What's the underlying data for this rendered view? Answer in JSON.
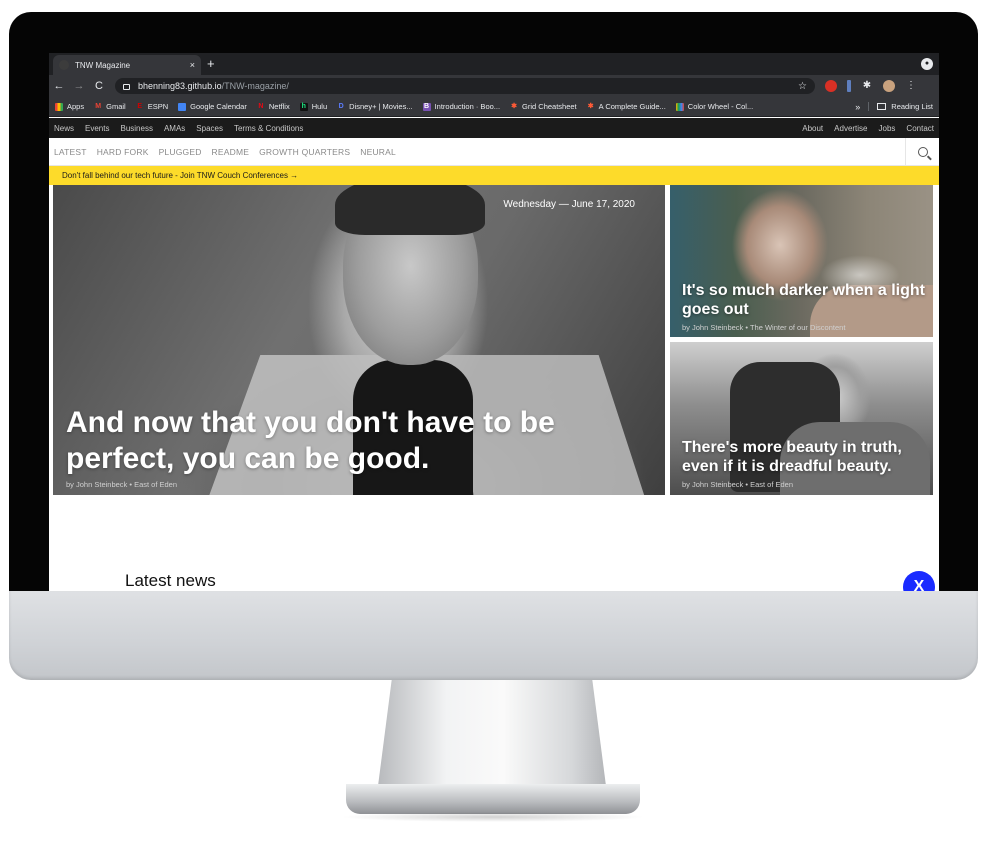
{
  "browser": {
    "tab_title": "TNW Magazine",
    "new_tab": "+",
    "tab_close": "×",
    "profile": "●",
    "url_host": "bhenning83.github.io",
    "url_path": "/TNW-magazine/",
    "back": "←",
    "forward": "→",
    "reload": "C",
    "star": "☆",
    "extensions_glyph": "✱",
    "menu_glyph": "⋮",
    "bookmarks": [
      {
        "label": "Apps",
        "icon": "apps-grid-icon",
        "color": "#ea4335"
      },
      {
        "label": "Gmail",
        "icon": "gmail-icon",
        "color": "#ea4335"
      },
      {
        "label": "ESPN",
        "icon": "espn-icon",
        "color": "#d00000"
      },
      {
        "label": "Google Calendar",
        "icon": "calendar-icon",
        "color": "#4285f4"
      },
      {
        "label": "Netflix",
        "icon": "netflix-icon",
        "color": "#e50914"
      },
      {
        "label": "Hulu",
        "icon": "hulu-icon",
        "color": "#1ce783"
      },
      {
        "label": "Disney+ | Movies...",
        "icon": "disney-icon",
        "color": "#113ccf"
      },
      {
        "label": "Introduction · Boo...",
        "icon": "bootstrap-icon",
        "color": "#7952b3"
      },
      {
        "label": "Grid Cheatsheet",
        "icon": "asterisk-icon",
        "color": "#ff5a36"
      },
      {
        "label": "A Complete Guide...",
        "icon": "asterisk-icon",
        "color": "#ff5a36"
      },
      {
        "label": "Color Wheel - Col...",
        "icon": "color-wheel-icon",
        "color": "#f4b400"
      }
    ],
    "bookmarks_more": "»",
    "reading_list": "Reading List"
  },
  "site": {
    "topnav_left": [
      "News",
      "Events",
      "Business",
      "AMAs",
      "Spaces",
      "Terms & Conditions"
    ],
    "topnav_right": [
      "About",
      "Advertise",
      "Jobs",
      "Contact"
    ],
    "sections": [
      "LATEST",
      "HARD FORK",
      "PLUGGED",
      "README",
      "GROWTH QUARTERS",
      "NEURAL"
    ],
    "banner": "Don't fall behind our tech future - Join TNW Couch Conferences →",
    "hero": {
      "date": "Wednesday — June 17, 2020",
      "title": "And now that you don't have to be perfect, you can be good.",
      "byline": "by John Steinbeck • East of Eden"
    },
    "side1": {
      "title": "It's so much darker when a light goes out",
      "byline": "by John Steinbeck • The Winter of our Discontent"
    },
    "side2": {
      "title": "There's more beauty in truth, even if it is dreadful beauty.",
      "byline": "by John Steinbeck • East of Eden"
    },
    "latest_heading": "Latest news",
    "close_label": "X"
  },
  "colors": {
    "banner": "#fddb2a",
    "fab": "#1a2bff",
    "topnav": "#1b1b1b"
  }
}
